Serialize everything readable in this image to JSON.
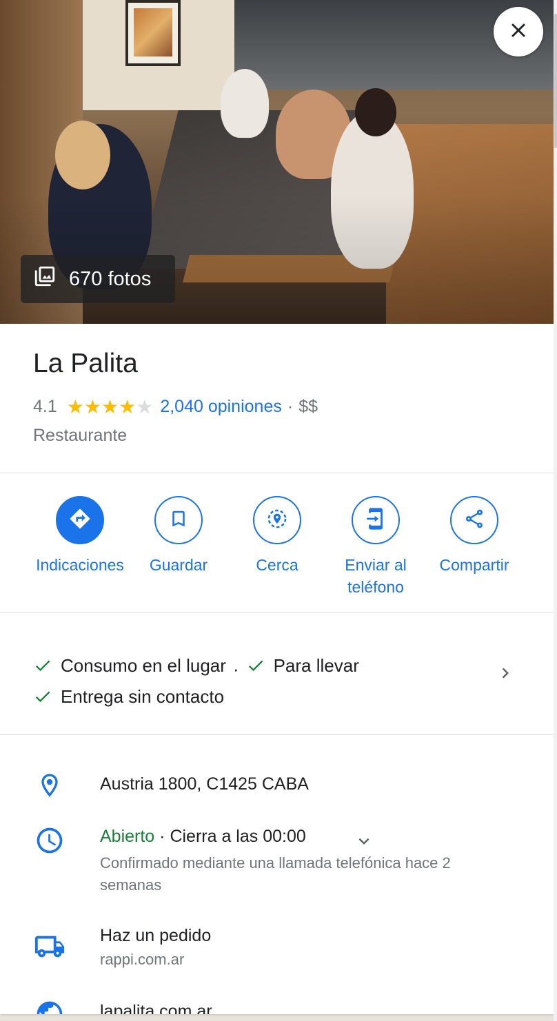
{
  "photos": {
    "count_label": "670 fotos"
  },
  "place": {
    "name": "La Palita",
    "rating": "4.1",
    "stars_filled": 4,
    "stars_total": 5,
    "reviews": "2,040 opiniones",
    "dot": "·",
    "price": "$$",
    "category": "Restaurante"
  },
  "actions": [
    {
      "label": "Indicaciones",
      "icon": "directions-icon"
    },
    {
      "label": "Guardar",
      "icon": "bookmark-icon"
    },
    {
      "label": "Cerca",
      "icon": "nearby-icon"
    },
    {
      "label": "Enviar al teléfono",
      "icon": "send-to-phone-icon"
    },
    {
      "label": "Compartir",
      "icon": "share-icon"
    }
  ],
  "services": [
    {
      "label": "Consumo en el lugar"
    },
    {
      "label": "Para llevar"
    },
    {
      "label": "Entrega sin contacto"
    }
  ],
  "services_sep": "·",
  "address": "Austria 1800, C1425 CABA",
  "hours": {
    "status": "Abierto",
    "detail": "· Cierra a las 00:00",
    "note": "Confirmado mediante una llamada telefónica hace 2 semanas"
  },
  "order": {
    "title": "Haz un pedido",
    "site": "rappi.com.ar"
  },
  "website": "lapalita.com.ar",
  "colors": {
    "accent": "#1a73e8",
    "open": "#188038",
    "star": "#fbbc04",
    "check": "#188038"
  }
}
